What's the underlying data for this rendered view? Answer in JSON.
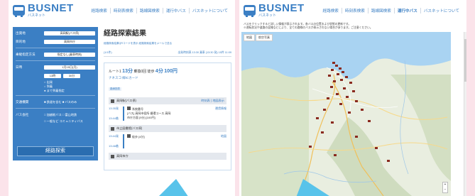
{
  "left": {
    "brand": {
      "name": "BUSNET",
      "sub": "バスネット"
    },
    "nav": [
      "経路検索",
      "時刻表検索",
      "路線図検索",
      "運行中バス",
      "バスネットについて"
    ],
    "sidebar": {
      "from_label": "出発地",
      "from_value": "高岡駅(バス停)",
      "to_label": "目的地",
      "to_value": "高岡市庁",
      "cond_label": "乗継指定方法",
      "cond_value": "指定なし(乗車時刻)",
      "date_label": "日時",
      "date_value": "1月15日(月)",
      "time_hour": "13時",
      "time_min": "30分",
      "time_opt1": "○ 出発",
      "time_opt2": "○ 到着",
      "time_opt3": "● まで到着指定",
      "transfer_label": "交通機関",
      "transfer_value": "■ 鉄道を含む ■ バスのみ",
      "company_label": "バス会社",
      "company_value": "□ 加越能バス □ 富山地鉄",
      "company_value2": "□ 一般など コミュニティバス",
      "search_button": "経路探索"
    },
    "content": {
      "title": "経路探索結果",
      "note": "経路検索結果QRコードを表示 経路検索結果をメールで送る",
      "bar_left": "(1/1件)",
      "bar_right": "出発時刻表 13:30 乗車 (13:30 発) 15件 11:09",
      "route_head_pre": "ルート1",
      "route_time": "13分",
      "route_mid": "乗換0回 徒歩",
      "route_walk": "4分",
      "route_fare": "100円",
      "route_sub": "ナネスコ 緑ICカード",
      "route_tag": "路線図表",
      "stop1": "高岡駅(バス停)",
      "stop1_right": "時刻表 | 地図表示",
      "leg1_t1": "13:35発",
      "leg1_t2": "13:44着",
      "leg1_line1": "系統番号",
      "leg1_line2": "[バス] 高岡市役所 循環コース 高岡",
      "leg1_line3": "市庁方面 [9分] [100円]",
      "leg1_link": "運賃情報",
      "stop2": "市立図書館(バス停)",
      "leg2_t1": "13:44発",
      "leg2_t2": "13:48着",
      "leg2_desc": "徒歩 [4分]",
      "leg2_link": "地図",
      "stop3": "高岡市庁"
    }
  },
  "right": {
    "brand": {
      "name": "BUSNET",
      "sub": "バスネット"
    },
    "nav": [
      "経路検索",
      "時刻表検索",
      "路線図検索",
      "運行中バス",
      "バスネットについて"
    ],
    "note1": "バスをクリックすると詳しい情報が表示されます。各バスの位置および状態の更新です。",
    "note2": "※運転状況や道路の混雑などにより、全ての路線のバスが表示されない場合があります。ご注意ください。",
    "map_tabs": [
      "地図",
      "航空写真"
    ],
    "zoom_in": "+",
    "zoom_out": "−"
  },
  "colors": {
    "brand": "#3b7fc4",
    "background": "#fbe3ea",
    "pointer": "#58c3ea"
  }
}
